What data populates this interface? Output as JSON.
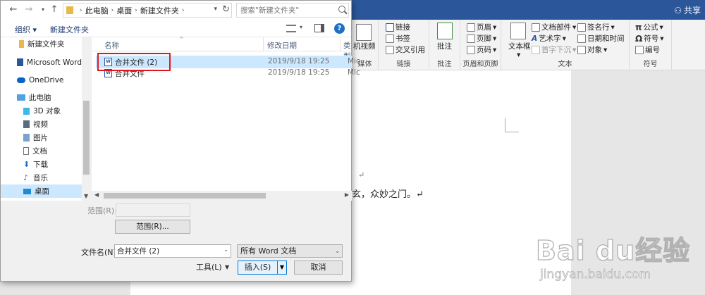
{
  "colors": {
    "word_blue": "#2b579a",
    "selection": "#cce8ff",
    "highlight": "#e0181e",
    "primary_border": "#0078d7"
  },
  "word": {
    "share_label": "共享",
    "ribbon": {
      "media": {
        "video_label": "机视频",
        "group_label": "媒体"
      },
      "links": {
        "link": "链接",
        "bookmark": "书签",
        "crossref": "交叉引用",
        "group_label": "链接"
      },
      "comments": {
        "comment": "批注",
        "group_label": "批注"
      },
      "header_footer": {
        "header": "页眉",
        "footer": "页脚",
        "page_number": "页码",
        "group_label": "页眉和页脚"
      },
      "text": {
        "textbox": "文本框",
        "doc_parts": "文档部件",
        "wordart": "艺术字",
        "dropcap": "首字下沉",
        "signature": "签名行",
        "datetime": "日期和时间",
        "object": "对象",
        "group_label": "文本"
      },
      "symbols": {
        "equation": "公式",
        "symbol": "符号",
        "numbering": "编号",
        "group_label": "符号"
      }
    },
    "document": {
      "line1_mark": "↵",
      "line2": "玄，众妙之门。↵"
    },
    "watermark": {
      "logo": "Bai du经验",
      "url": "jingyan.baidu.com"
    }
  },
  "dialog": {
    "breadcrumbs": [
      "此电脑",
      "桌面",
      "新建文件夹"
    ],
    "search_placeholder": "搜索\"新建文件夹\"",
    "toolbar": {
      "organize": "组织 ▾",
      "new_folder": "新建文件夹",
      "help": "?"
    },
    "nav_items": [
      {
        "label": "新建文件夹"
      },
      {
        "label": "Microsoft Word"
      },
      {
        "label": "OneDrive"
      },
      {
        "label": "此电脑"
      },
      {
        "label": "3D 对象"
      },
      {
        "label": "视频"
      },
      {
        "label": "图片"
      },
      {
        "label": "文档"
      },
      {
        "label": "下载"
      },
      {
        "label": "音乐"
      },
      {
        "label": "桌面"
      }
    ],
    "columns": {
      "name": "名称",
      "date": "修改日期",
      "type": "类型"
    },
    "files": [
      {
        "name": "合并文件 (2)",
        "date": "2019/9/18 19:25",
        "type": "Mic"
      },
      {
        "name": "合并文件",
        "date": "2019/9/18 19:25",
        "type": "Mic"
      }
    ],
    "range_label": "范围(R):",
    "range_button": "范围(R)...",
    "filename_label": "文件名(N):",
    "filename_value": "合并文件 (2)",
    "filetype_value": "所有 Word 文档",
    "tools_label": "工具(L)",
    "insert_label": "插入(S)",
    "cancel_label": "取消"
  }
}
